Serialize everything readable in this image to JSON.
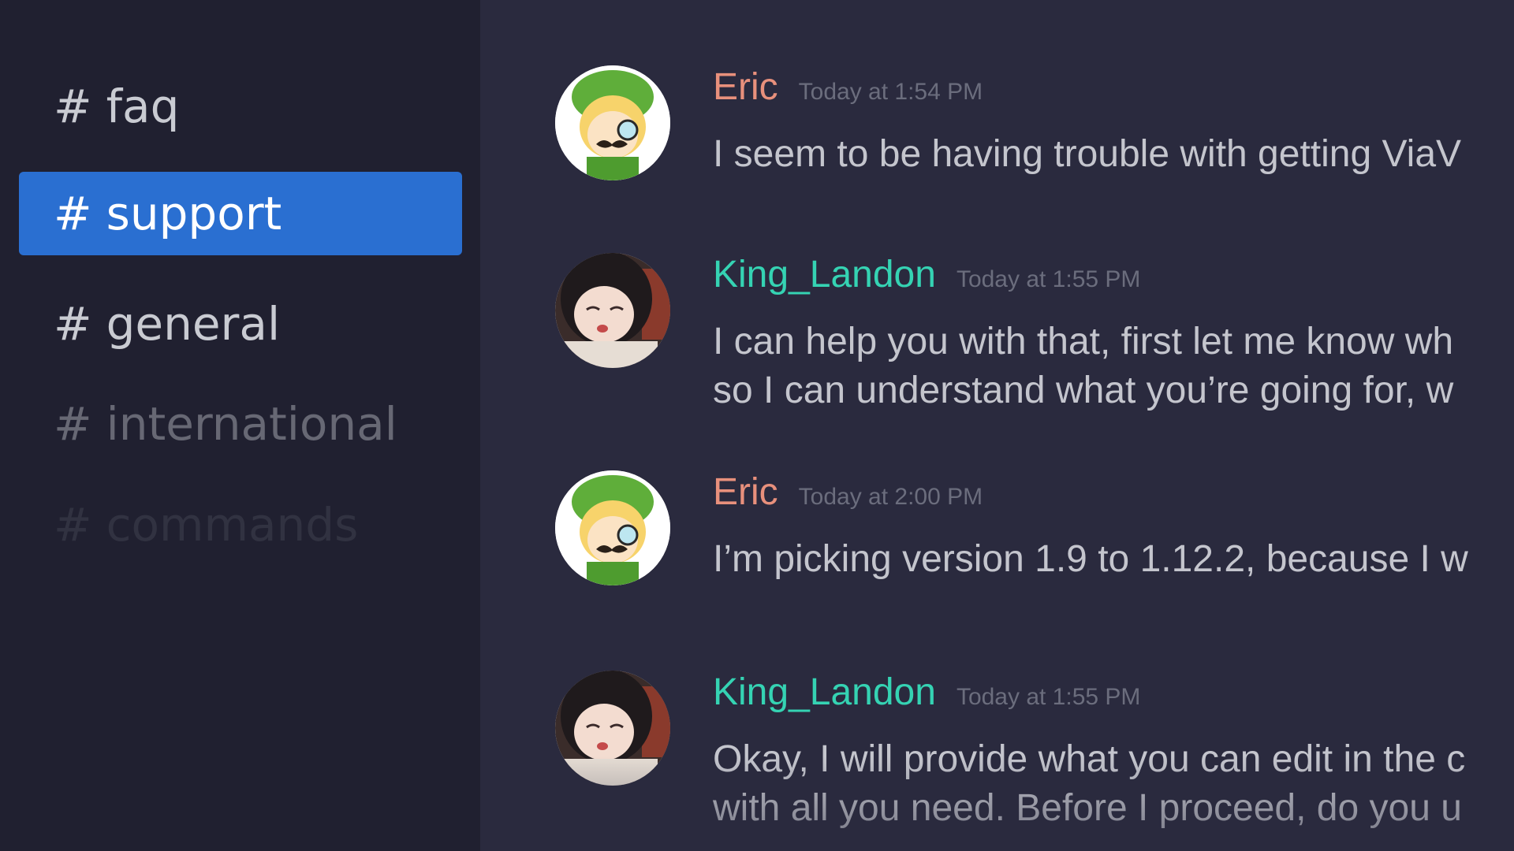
{
  "sidebar": {
    "channels": [
      {
        "hash": "#",
        "name": "faq"
      },
      {
        "hash": "#",
        "name": "support"
      },
      {
        "hash": "#",
        "name": "general"
      },
      {
        "hash": "#",
        "name": "international"
      },
      {
        "hash": "#",
        "name": "commands"
      }
    ],
    "active_channel": "support"
  },
  "colors": {
    "eric": "#e8907c",
    "king_landon": "#35d3b3",
    "active_channel_bg": "#2a6fd1"
  },
  "messages": [
    {
      "author": "Eric",
      "avatar": "link-character-avatar",
      "timestamp": "Today at 1:54 PM",
      "lines": [
        "I seem to be having trouble with getting ViaV"
      ]
    },
    {
      "author": "King_Landon",
      "avatar": "anime-girl-avatar",
      "timestamp": "Today at 1:55 PM",
      "lines": [
        "I can help you with that, first let me know wh",
        "so I can understand what you’re going for, w"
      ]
    },
    {
      "author": "Eric",
      "avatar": "link-character-avatar",
      "timestamp": "Today at 2:00 PM",
      "lines": [
        "I’m picking version 1.9 to 1.12.2, because I w"
      ]
    },
    {
      "author": "King_Landon",
      "avatar": "anime-girl-avatar",
      "timestamp": "Today at 1:55 PM",
      "lines": [
        "Okay, I will provide what you can edit in the c",
        "with all you need. Before I proceed, do you u"
      ]
    }
  ]
}
